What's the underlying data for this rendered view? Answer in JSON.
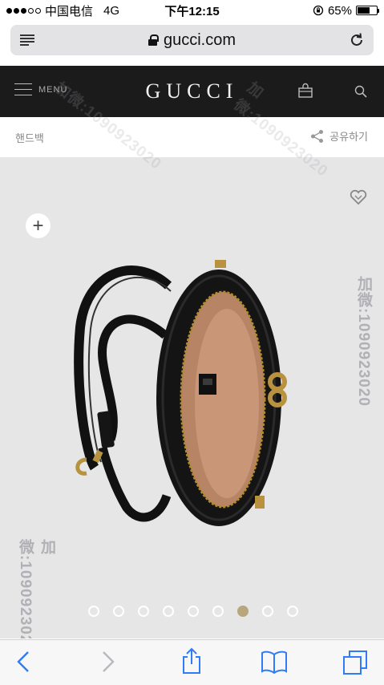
{
  "status_bar": {
    "carrier": "中国电信",
    "network": "4G",
    "time": "下午12:15",
    "battery": "65%",
    "battery_level": 0.65
  },
  "address_bar": {
    "url": "gucci.com"
  },
  "site_header": {
    "menu_label": "MENU",
    "brand": "GUCCI"
  },
  "breadcrumb": {
    "category": "핸드백",
    "share_label": "공유하기"
  },
  "gallery": {
    "plus": "+",
    "slide_count": 9,
    "active_slide": 7
  },
  "watermark": {
    "text": "加微:1090923020"
  },
  "colors": {
    "header_bg": "#1b1b1b",
    "gallery_bg": "#e6e6e7",
    "active_dot": "#b8a67c",
    "ios_blue": "#2f7cf6"
  }
}
